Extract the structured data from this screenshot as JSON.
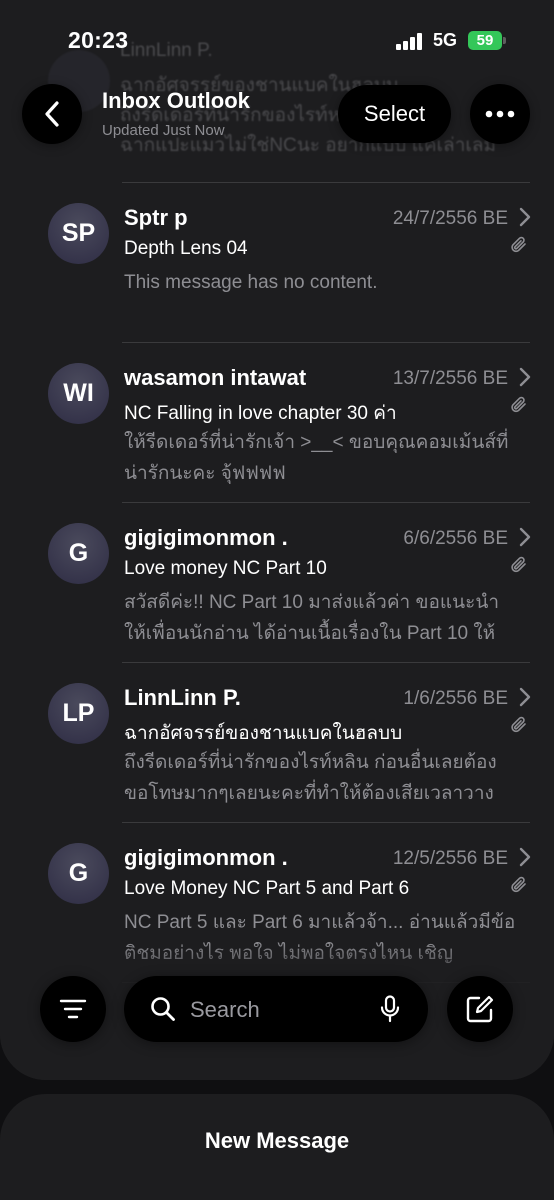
{
  "status": {
    "time": "20:23",
    "network": "5G",
    "battery": "59"
  },
  "nav": {
    "title": "Inbox Outlook",
    "subtitle": "Updated Just Now",
    "select_label": "Select"
  },
  "peek": {
    "sender": "LinnLinn P.",
    "line1": "ฉากอัศจรรย์ของชานแบคในฮลบบ",
    "line2": "ถึงรีดเดอร์ที่น่ารักของไรท์หลิน ก่อนอื่น",
    "line3": "ฉากแปะแมวไม่ใช่NCนะ อยากแบบ แค่เล่าเลม"
  },
  "messages": [
    {
      "initials": "SP",
      "sender": "Sptr p",
      "date": "24/7/2556 BE",
      "subject": "Depth Lens 04",
      "preview": "This message has no content."
    },
    {
      "initials": "WI",
      "sender": "wasamon intawat",
      "date": "13/7/2556 BE",
      "subject": "NC Falling in love chapter 30 ค่า",
      "preview": "ให้รีดเดอร์ที่น่ารักเจ้า >__< ขอบคุณคอมเม้นส์ที่น่ารักนะคะ จุ้ฟฟฟฟ"
    },
    {
      "initials": "G",
      "sender": "gigigimonmon .",
      "date": "6/6/2556 BE",
      "subject": "Love money NC Part 10",
      "preview": "สวัสดีค่ะ!! NC Part 10 มาส่งแล้วค่า ขอแนะนำให้เพื่อนนักอ่าน ได้อ่านเนื้อเรื่องใน Part 10 ให้"
    },
    {
      "initials": "LP",
      "sender": "LinnLinn P.",
      "date": "1/6/2556 BE",
      "subject": "ฉากอัศจรรย์ของชานแบคในฮลบบ",
      "preview": "ถึงรีดเดอร์ที่น่ารักของไรท์หลิน ก่อนอื่นเลยต้องขอโทษมากๆเลยนะคะที่ทำให้ต้องเสียเวลาวาง"
    },
    {
      "initials": "G",
      "sender": "gigigimonmon .",
      "date": "12/5/2556 BE",
      "subject": "Love Money NC Part 5 and Part 6",
      "preview": "NC Part 5 และ Part 6 มาแล้วจ้า... อ่านแล้วมีข้อติชมอย่างไร พอใจ ไม่พอใจตรงไหน เชิญ"
    }
  ],
  "search": {
    "placeholder": "Search"
  },
  "new_message": "New Message",
  "colors": {
    "background": "#1d1d1f",
    "secondary_text": "#8e8e93",
    "battery": "#34c759",
    "avatar": "#36344a"
  }
}
